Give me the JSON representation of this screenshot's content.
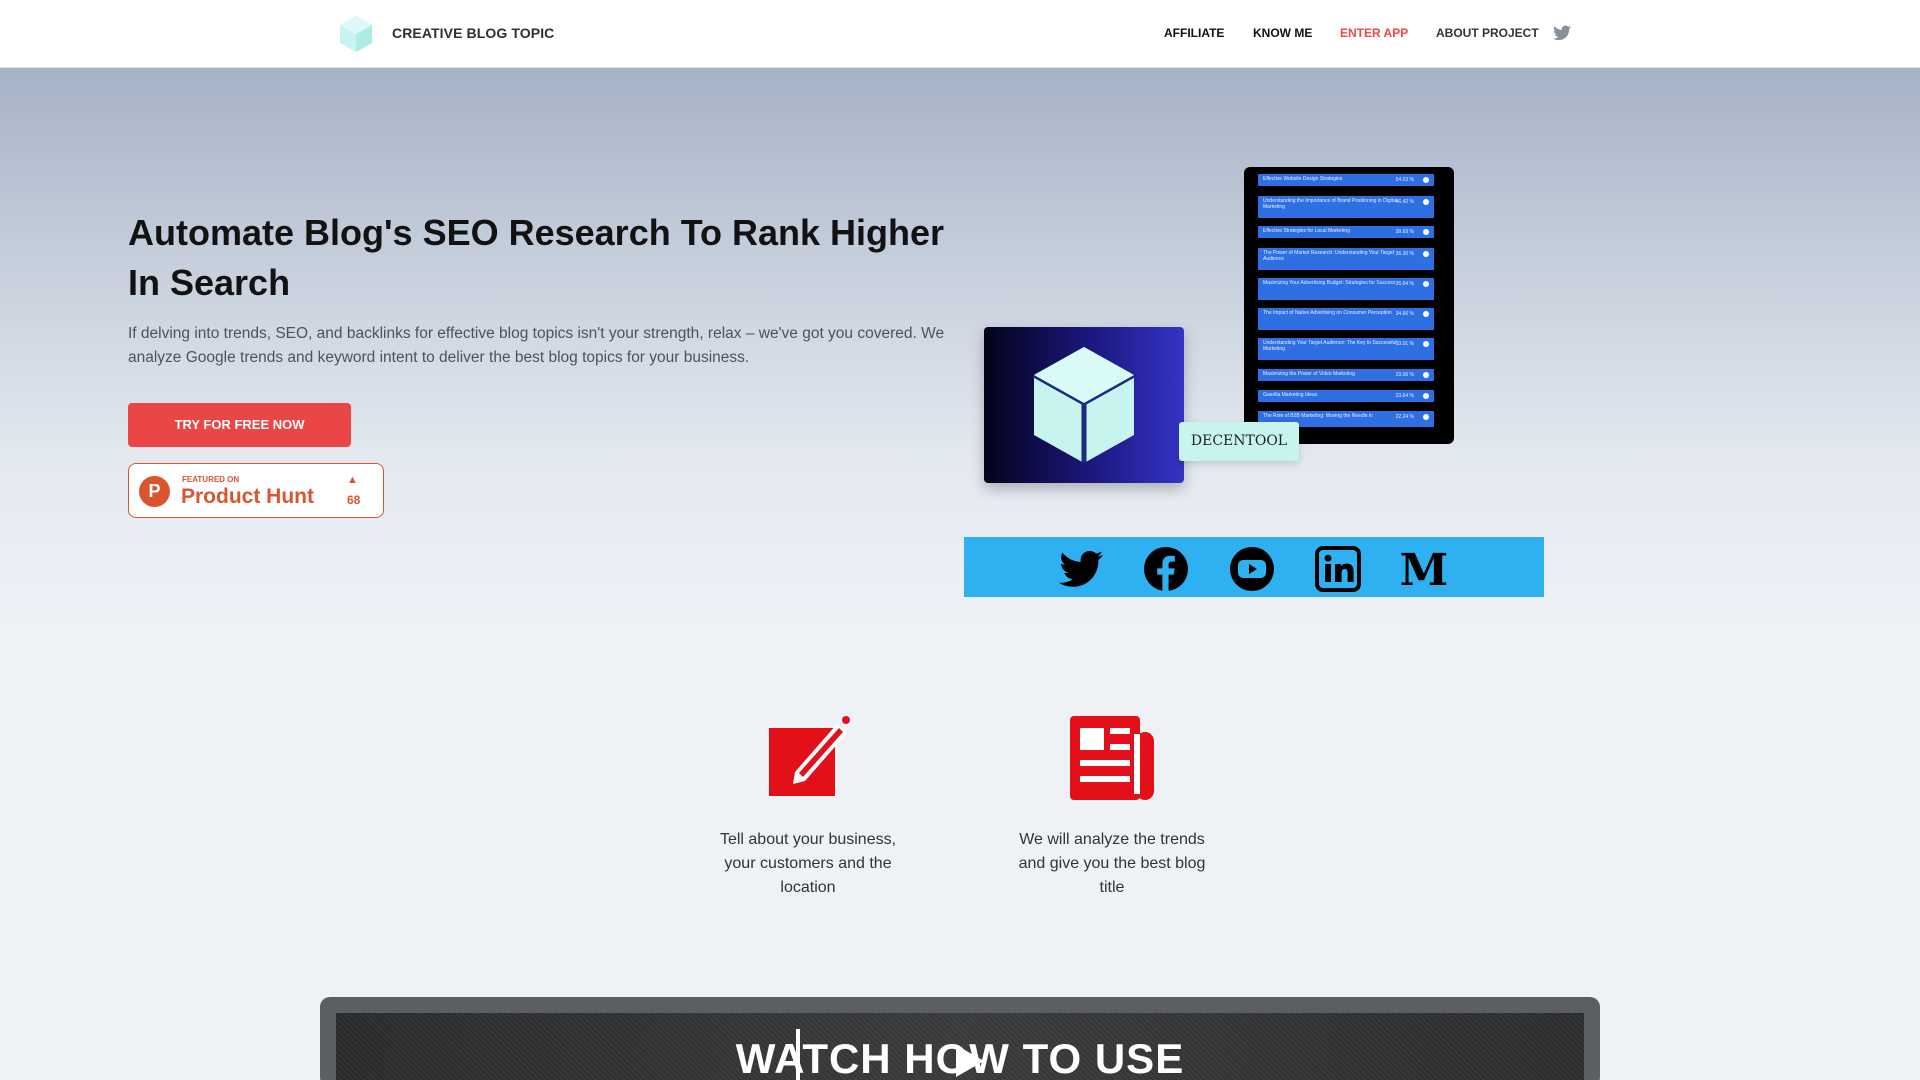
{
  "header": {
    "brand": "CREATIVE BLOG TOPIC",
    "nav": {
      "affiliate": "AFFILIATE",
      "know_me": "KNOW ME",
      "enter_app": "ENTER APP",
      "about_project": "ABOUT PROJECT"
    },
    "twitter_icon": "twitter-icon"
  },
  "hero": {
    "title": "Automate Blog's SEO Research To Rank Higher In Search",
    "description": "If delving into trends, SEO, and backlinks for effective blog topics isn't your strength, relax – we've got you covered. We analyze Google trends and keyword intent to deliver the best blog topics for your business.",
    "cta_label": "TRY FOR FREE NOW",
    "product_hunt": {
      "small": "FEATURED ON",
      "big": "Product Hunt",
      "votes": "68"
    },
    "card_label": "DECENTOOL",
    "phone_rows": [
      {
        "title": "Effective Website Design Strategies",
        "pct": "54.03 %"
      },
      {
        "title": "Understanding the Importance of Brand Positioning in Digital Marketing",
        "pct": "46.42 %"
      },
      {
        "title": "Effective Strategies for Local Marketing",
        "pct": "39.69 %"
      },
      {
        "title": "The Power of Market Research: Understanding Your Target Audience",
        "pct": "36.30 %"
      },
      {
        "title": "Maximizing Your Advertising Budget: Strategies for Success",
        "pct": "35.64 %"
      },
      {
        "title": "The Impact of Native Advertising on Consumer Perception",
        "pct": "34.66 %"
      },
      {
        "title": "Understanding Your Target Audience: The Key to Successful Marketing",
        "pct": "33.01 %"
      },
      {
        "title": "Maximizing the Power of Video Marketing",
        "pct": "29.06 %"
      },
      {
        "title": "Guerilla Marketing Ideas",
        "pct": "23.64 %"
      },
      {
        "title": "The Role of B2B Marketing: Moving the Needle in",
        "pct": "22.24 %"
      }
    ],
    "social_icons": [
      "twitter-icon",
      "facebook-icon",
      "youtube-icon",
      "linkedin-icon",
      "medium-icon"
    ]
  },
  "features": [
    {
      "icon": "edit-icon",
      "text": "Tell about your business, your customers and the location"
    },
    {
      "icon": "newspaper-icon",
      "text": "We will analyze the trends and give you the best blog title"
    }
  ],
  "video": {
    "title": "WATCH HOW TO USE"
  },
  "colors": {
    "accent": "#ea4646",
    "product_hunt": "#da552f",
    "social_strip": "#2eb0f1",
    "cube": "#c8f4f0"
  }
}
